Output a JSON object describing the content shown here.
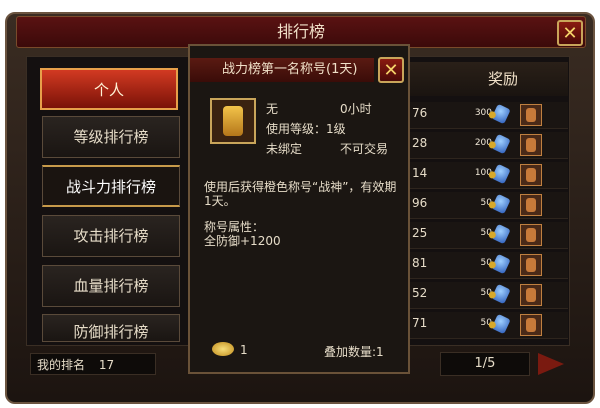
{
  "window": {
    "title": "排行榜",
    "close_label": "✕"
  },
  "nav": {
    "items": [
      {
        "label": "个人",
        "active": true
      },
      {
        "label": "等级排行榜"
      },
      {
        "label": "战斗力排行榜",
        "highlighted": true
      },
      {
        "label": "攻击排行榜"
      },
      {
        "label": "血量排行榜"
      },
      {
        "label": "防御排行榜"
      }
    ]
  },
  "my_rank": {
    "label": "我的排名",
    "value": "17"
  },
  "rewards": {
    "header": "奖励",
    "rows": [
      {
        "partial_value": "76",
        "amount": "300"
      },
      {
        "partial_value": "28",
        "amount": "200"
      },
      {
        "partial_value": "14",
        "amount": "100"
      },
      {
        "partial_value": "96",
        "amount": "50"
      },
      {
        "partial_value": "25",
        "amount": "50"
      },
      {
        "partial_value": "81",
        "amount": "50"
      },
      {
        "partial_value": "52",
        "amount": "50"
      },
      {
        "partial_value": "71",
        "amount": "50"
      }
    ]
  },
  "pagination": {
    "text": "1/5"
  },
  "tooltip": {
    "title": "战力榜第一名称号(1天)",
    "close_label": "✕",
    "line1_left": "无",
    "line1_right": "0小时",
    "line2": "使用等级：1级",
    "line3_left": "未绑定",
    "line3_right": "不可交易",
    "description": "使用后获得橙色称号“战神”，有效期1天。",
    "attr_title": "称号属性：",
    "attr_value": "全防御+1200",
    "price": "1",
    "stack_label": "叠加数量:1"
  },
  "colors": {
    "accent_red": "#c8321e",
    "gold": "#c9a55a"
  }
}
